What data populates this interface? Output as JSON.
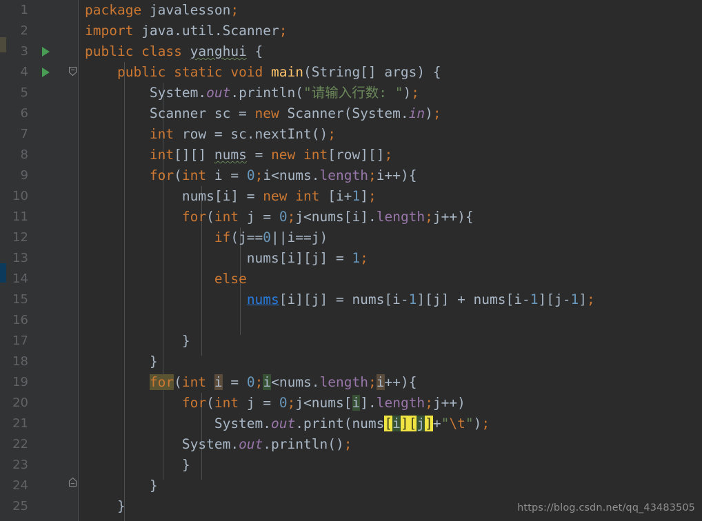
{
  "editor": {
    "theme_name": "Darcula",
    "colors": {
      "background": "#2b2b2b",
      "gutter_background": "#313335",
      "line_number": "#606366",
      "default_text": "#a9b7c6",
      "keyword": "#cc7832",
      "number": "#6897bb",
      "string": "#6a8759",
      "static_field": "#9876aa",
      "instance_field": "#9876aa",
      "link": "#287bde",
      "run_marker": "#499c54",
      "write_highlight": "#5b4b3a",
      "read_highlight": "#375135",
      "keyword_match_highlight": "#5a5433",
      "brace_match_highlight": "#f0e442",
      "vcs_changed_marker": "#0b3a5c",
      "vcs_modified_marker": "#4e4a3c"
    },
    "gutter": {
      "run_markers": [
        "3",
        "4"
      ],
      "fold_markers": [
        "4",
        "24"
      ],
      "intention_bulb_line": "21",
      "vcs_marker_lines": [
        "3",
        "14"
      ]
    },
    "watermark": "https://blog.csdn.net/qq_43483505",
    "language": "Java",
    "lines": [
      {
        "n": "1",
        "text": "package javalesson;"
      },
      {
        "n": "2",
        "text": "import java.util.Scanner;"
      },
      {
        "n": "3",
        "text": "public class yanghui {"
      },
      {
        "n": "4",
        "text": "    public static void main(String[] args) {"
      },
      {
        "n": "5",
        "text": "        System.out.println(\"请输入行数: \");"
      },
      {
        "n": "6",
        "text": "        Scanner sc = new Scanner(System.in);"
      },
      {
        "n": "7",
        "text": "        int row = sc.nextInt();"
      },
      {
        "n": "8",
        "text": "        int[][] nums = new int[row][];"
      },
      {
        "n": "9",
        "text": "        for(int i = 0;i<nums.length;i++){"
      },
      {
        "n": "10",
        "text": "            nums[i] = new int [i+1];"
      },
      {
        "n": "11",
        "text": "            for(int j = 0;j<nums[i].length;j++){"
      },
      {
        "n": "12",
        "text": "                if(j==0||i==j)"
      },
      {
        "n": "13",
        "text": "                    nums[i][j] = 1;"
      },
      {
        "n": "14",
        "text": "                else"
      },
      {
        "n": "15",
        "text": "                    nums[i][j] = nums[i-1][j] + nums[i-1][j-1];"
      },
      {
        "n": "16",
        "text": ""
      },
      {
        "n": "17",
        "text": "            }"
      },
      {
        "n": "18",
        "text": "        }"
      },
      {
        "n": "19",
        "text": "        for(int i = 0;i<nums.length;i++){"
      },
      {
        "n": "20",
        "text": "            for(int j = 0;j<nums[i].length;j++)"
      },
      {
        "n": "21",
        "text": "                System.out.print(nums[i][j]+\"\\t\");"
      },
      {
        "n": "22",
        "text": "            System.out.println();"
      },
      {
        "n": "23",
        "text": "            }"
      },
      {
        "n": "24",
        "text": "        }"
      },
      {
        "n": "25",
        "text": "    }"
      }
    ]
  }
}
